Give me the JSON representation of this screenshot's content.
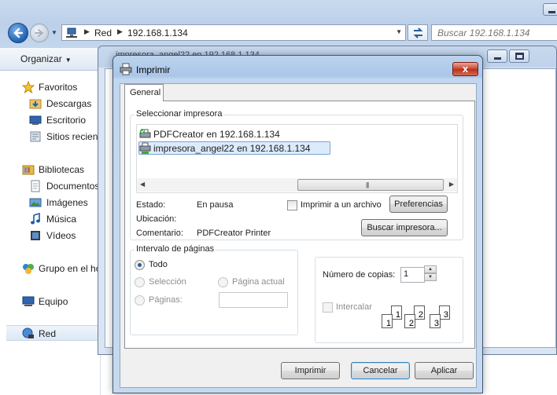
{
  "explorer": {
    "address_segments": [
      "Red",
      "192.168.1.134"
    ],
    "search_placeholder": "Buscar 192.168.1.134",
    "toolbar": {
      "organize_label": "Organizar"
    },
    "background_window_title": "impresora_angel22 en 192.168.1.134",
    "nav": {
      "favorites": "Favoritos",
      "downloads": "Descargas",
      "desktop": "Escritorio",
      "recent": "Sitios recientes",
      "libraries": "Bibliotecas",
      "documents": "Documentos",
      "images": "Imágenes",
      "music": "Música",
      "videos": "Vídeos",
      "homegroup": "Grupo en el hogar",
      "computer": "Equipo",
      "network": "Red"
    }
  },
  "dialog": {
    "title": "Imprimir",
    "close_glyph": "x",
    "tab_general": "General",
    "select_printer_label": "Seleccionar impresora",
    "printers": [
      {
        "name": "PDFCreator en 192.168.1.134",
        "selected": false
      },
      {
        "name": "impresora_angel22 en 192.168.1.134",
        "selected": true
      }
    ],
    "status_label": "Estado:",
    "status_value": "En pausa",
    "location_label": "Ubicación:",
    "location_value": "",
    "comment_label": "Comentario:",
    "comment_value": "PDFCreator Printer",
    "print_to_file_label": "Imprimir a un archivo",
    "print_to_file_checked": false,
    "preferences_button": "Preferencias",
    "find_printer_button": "Buscar impresora...",
    "page_range_label": "Intervalo de páginas",
    "range_all": "Todo",
    "range_selection": "Selección",
    "range_current": "Página actual",
    "range_pages": "Páginas:",
    "range_selected": "Todo",
    "pages_value": "",
    "copies_label": "Número de copias:",
    "copies_value": "1",
    "collate_label": "Intercalar",
    "collate_checked": false,
    "collate_pages": [
      "1",
      "1",
      "2",
      "2",
      "3",
      "3"
    ],
    "print_button": "Imprimir",
    "cancel_button": "Cancelar",
    "apply_button": "Aplicar"
  },
  "colors": {
    "accent": "#3c7fb1",
    "close_button": "#c9412b",
    "selection": "#dcebfc"
  }
}
